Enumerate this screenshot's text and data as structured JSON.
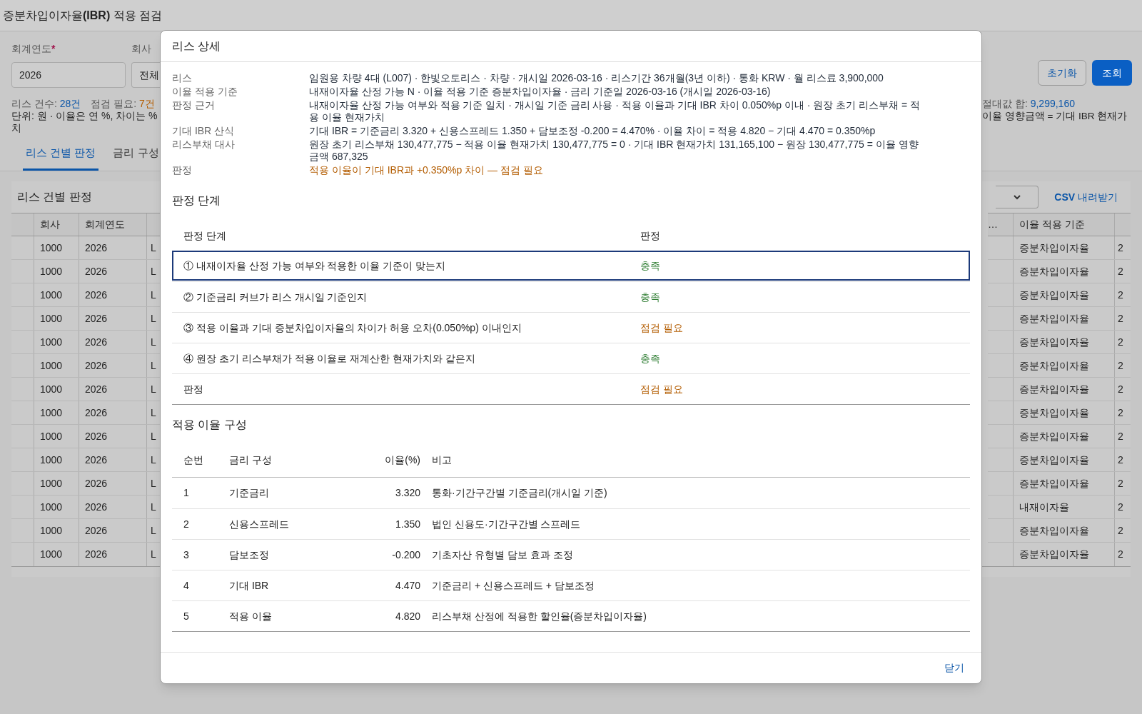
{
  "page": {
    "title_prefix": "증분차입이자율",
    "title_bold": "(IBR)",
    "title_suffix": " 적용 점검"
  },
  "filters": {
    "year_label": "회계연도",
    "year_required_mark": "*",
    "year_value": "2026",
    "company_label": "회사",
    "company_value": "전체",
    "buttons": [
      {
        "label": "초기화",
        "kind": "secondary"
      },
      {
        "label": "조회",
        "kind": "primary"
      }
    ]
  },
  "summary": {
    "count_label": "리스 건수:",
    "count_value": "28건",
    "check_label": "점검 필요:",
    "check_value": "7건",
    "unit_note": "단위: 원 · 이율은 연 %, 차이는 %",
    "unit_note_end": "치",
    "abs_label": "절대값 합:",
    "abs_value": "9,299,160",
    "formula_note": "이율 영향금액 = 기대 IBR 현재가"
  },
  "tabs": [
    {
      "label": "리스 건별 판정",
      "selected": true
    },
    {
      "label": "금리 구성",
      "selected": false
    }
  ],
  "table": {
    "title": "리스 건별 판정",
    "csv_link": "CSV 내려받기",
    "left_columns": [
      "회사",
      "회계연도"
    ],
    "right_columns": [
      "…",
      "이율 적용 기준"
    ],
    "rows": [
      {
        "company": "1000",
        "year": "2026",
        "column_3": "L",
        "basis": "증분차입이자율",
        "column_last": "2"
      },
      {
        "company": "1000",
        "year": "2026",
        "column_3": "L",
        "basis": "증분차입이자율",
        "column_last": "2"
      },
      {
        "company": "1000",
        "year": "2026",
        "column_3": "L",
        "basis": "증분차입이자율",
        "column_last": "2"
      },
      {
        "company": "1000",
        "year": "2026",
        "column_3": "L",
        "basis": "증분차입이자율",
        "column_last": "2"
      },
      {
        "company": "1000",
        "year": "2026",
        "column_3": "L",
        "basis": "증분차입이자율",
        "column_last": "2"
      },
      {
        "company": "1000",
        "year": "2026",
        "column_3": "L",
        "basis": "증분차입이자율",
        "column_last": "2"
      },
      {
        "company": "1000",
        "year": "2026",
        "column_3": "L",
        "basis": "증분차입이자율",
        "column_last": "2"
      },
      {
        "company": "1000",
        "year": "2026",
        "column_3": "L",
        "basis": "증분차입이자율",
        "column_last": "2"
      },
      {
        "company": "1000",
        "year": "2026",
        "column_3": "L",
        "basis": "증분차입이자율",
        "column_last": "2"
      },
      {
        "company": "1000",
        "year": "2026",
        "column_3": "L",
        "basis": "증분차입이자율",
        "column_last": "2"
      },
      {
        "company": "1000",
        "year": "2026",
        "column_3": "L",
        "basis": "증분차입이자율",
        "column_last": "2"
      },
      {
        "company": "1000",
        "year": "2026",
        "column_3": "L",
        "basis": "내재이자율",
        "column_last": "2"
      },
      {
        "company": "1000",
        "year": "2026",
        "column_3": "L",
        "basis": "증분차입이자율",
        "column_last": "2"
      },
      {
        "company": "1000",
        "year": "2026",
        "column_3": "L",
        "basis": "증분차입이자율",
        "column_last": "2"
      }
    ]
  },
  "dialog": {
    "title": "리스 상세",
    "details": [
      {
        "label": "리스",
        "value": "임원용 차량 4대 (L007) · 한빛오토리스 · 차량 · 개시일 2026-03-16 · 리스기간 36개월(3년 이하) · 통화 KRW · 월 리스료 3,900,000",
        "kind": "normal"
      },
      {
        "label": "이율 적용 기준",
        "value": "내재이자율 산정 가능 N · 이율 적용 기준 증분차입이자율 · 금리 기준일 2026-03-16 (개시일 2026-03-16)",
        "kind": "normal"
      },
      {
        "label": "판정 근거",
        "value": "내재이자율 산정 가능 여부와 적용 기준 일치 · 개시일 기준 금리 사용 · 적용 이율과 기대 IBR 차이 0.050%p 이내 · 원장 초기 리스부채 = 적용 이율 현재가치",
        "kind": "normal"
      },
      {
        "label": "기대 IBR 산식",
        "value": "기대 IBR = 기준금리 3.320 + 신용스프레드 1.350 + 담보조정 -0.200 = 4.470% · 이율 차이 = 적용 4.820 − 기대 4.470 = 0.350%p",
        "kind": "normal"
      },
      {
        "label": "리스부채 대사",
        "value": "원장 초기 리스부채 130,477,775 − 적용 이율 현재가치 130,477,775 = 0 · 기대 IBR 현재가치 131,165,100 − 원장 130,477,775 = 이율 영향금액 687,325",
        "kind": "normal"
      },
      {
        "label": "판정",
        "value": "적용 이율이 기대 IBR과 +0.350%p 차이 — 점검 필요",
        "kind": "warning"
      }
    ],
    "steps_title": "판정 단계",
    "steps_columns": [
      "판정 단계",
      "판정"
    ],
    "steps": [
      {
        "step": "① 내재이자율 산정 가능 여부와 적용한 이율 기준이 맞는지",
        "result": "충족",
        "kind": "pass",
        "selected": true
      },
      {
        "step": "② 기준금리 커브가 리스 개시일 기준인지",
        "result": "충족",
        "kind": "pass",
        "selected": false
      },
      {
        "step": "③ 적용 이율과 기대 증분차입이자율의 차이가 허용 오차(0.050%p) 이내인지",
        "result": "점검 필요",
        "kind": "fail",
        "selected": false
      },
      {
        "step": "④ 원장 초기 리스부채가 적용 이율로 재계산한 현재가치와 같은지",
        "result": "충족",
        "kind": "pass",
        "selected": false
      },
      {
        "step": "판정",
        "result": "점검 필요",
        "kind": "fail",
        "selected": false
      }
    ],
    "rates_title": "적용 이율 구성",
    "rates_columns": [
      "순번",
      "금리 구성",
      "이율(%)",
      "비고"
    ],
    "rates": [
      {
        "no": "1",
        "component": "기준금리",
        "rate": "3.320",
        "note": "통화·기간구간별 기준금리(개시일 기준)"
      },
      {
        "no": "2",
        "component": "신용스프레드",
        "rate": "1.350",
        "note": "법인 신용도·기간구간별 스프레드"
      },
      {
        "no": "3",
        "component": "담보조정",
        "rate": "-0.200",
        "note": "기초자산 유형별 담보 효과 조정"
      },
      {
        "no": "4",
        "component": "기대 IBR",
        "rate": "4.470",
        "note": "기준금리 + 신용스프레드 + 담보조정"
      },
      {
        "no": "5",
        "component": "적용 이율",
        "rate": "4.820",
        "note": "리스부채 산정에 적용한 할인율(증분차입이자율)"
      }
    ],
    "close_button": "닫기"
  }
}
